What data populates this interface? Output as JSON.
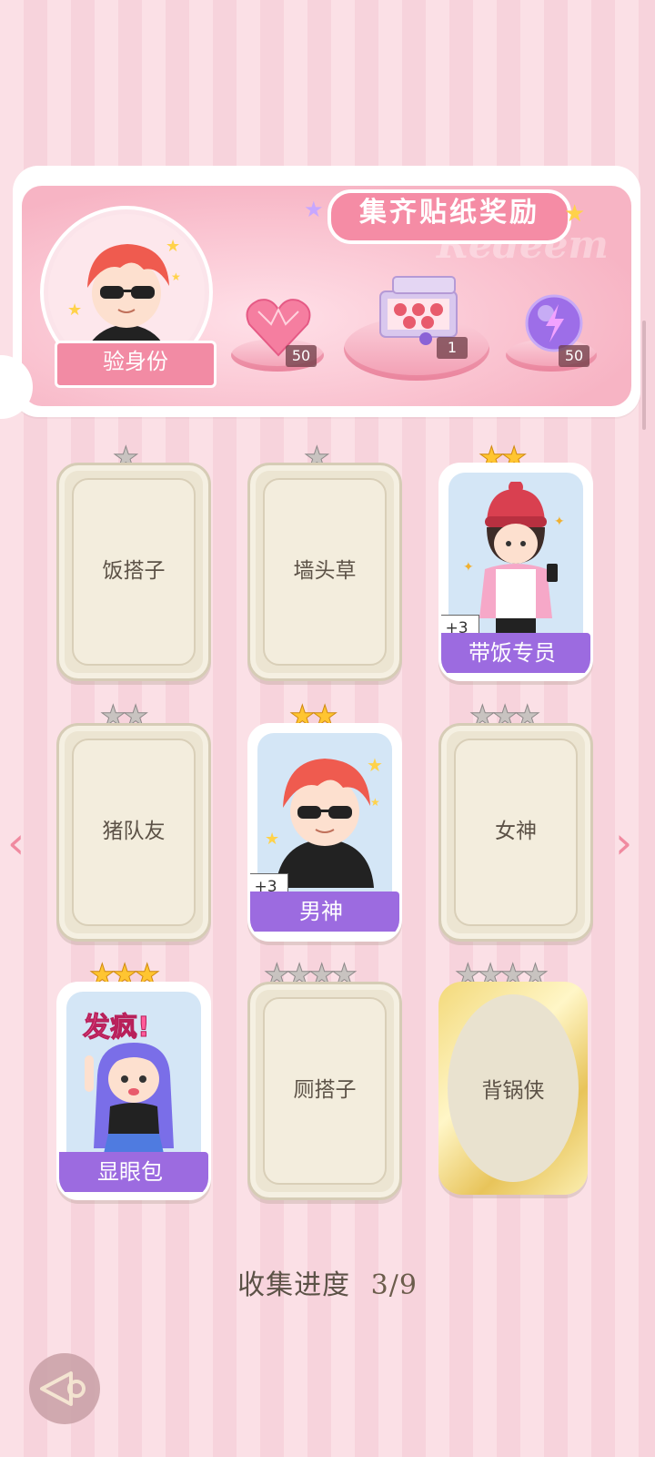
{
  "reward": {
    "title": "集齐贴纸奖励",
    "watermark": "Redeem",
    "identity_label": "验身份",
    "items": [
      {
        "icon": "pink-heart-gem-icon",
        "count": "50"
      },
      {
        "icon": "gift-box-icon",
        "count": "1"
      },
      {
        "icon": "purple-lightning-orb-icon",
        "count": "50"
      }
    ]
  },
  "cards": [
    {
      "name": "饭搭子",
      "stars": 1,
      "collected": false
    },
    {
      "name": "墙头草",
      "stars": 1,
      "collected": false
    },
    {
      "name": "带饭专员",
      "stars": 2,
      "collected": true,
      "bonus": "+3"
    },
    {
      "name": "猪队友",
      "stars": 2,
      "collected": false
    },
    {
      "name": "男神",
      "stars": 2,
      "collected": true,
      "bonus": "+3"
    },
    {
      "name": "女神",
      "stars": 3,
      "collected": false
    },
    {
      "name": "显眼包",
      "stars": 3,
      "collected": true,
      "art_text": "发疯!"
    },
    {
      "name": "厕搭子",
      "stars": 4,
      "collected": false
    },
    {
      "name": "背锅侠",
      "stars": 4,
      "collected": false,
      "gold_frame": true
    }
  ],
  "progress": {
    "label": "收集进度",
    "value": "3/9"
  },
  "nav": {
    "prev": "‹",
    "next": "›"
  },
  "colors": {
    "accent_pink": "#f58ca5",
    "ribbon_purple": "#9c6be0",
    "star_gold": "#ffc531"
  }
}
